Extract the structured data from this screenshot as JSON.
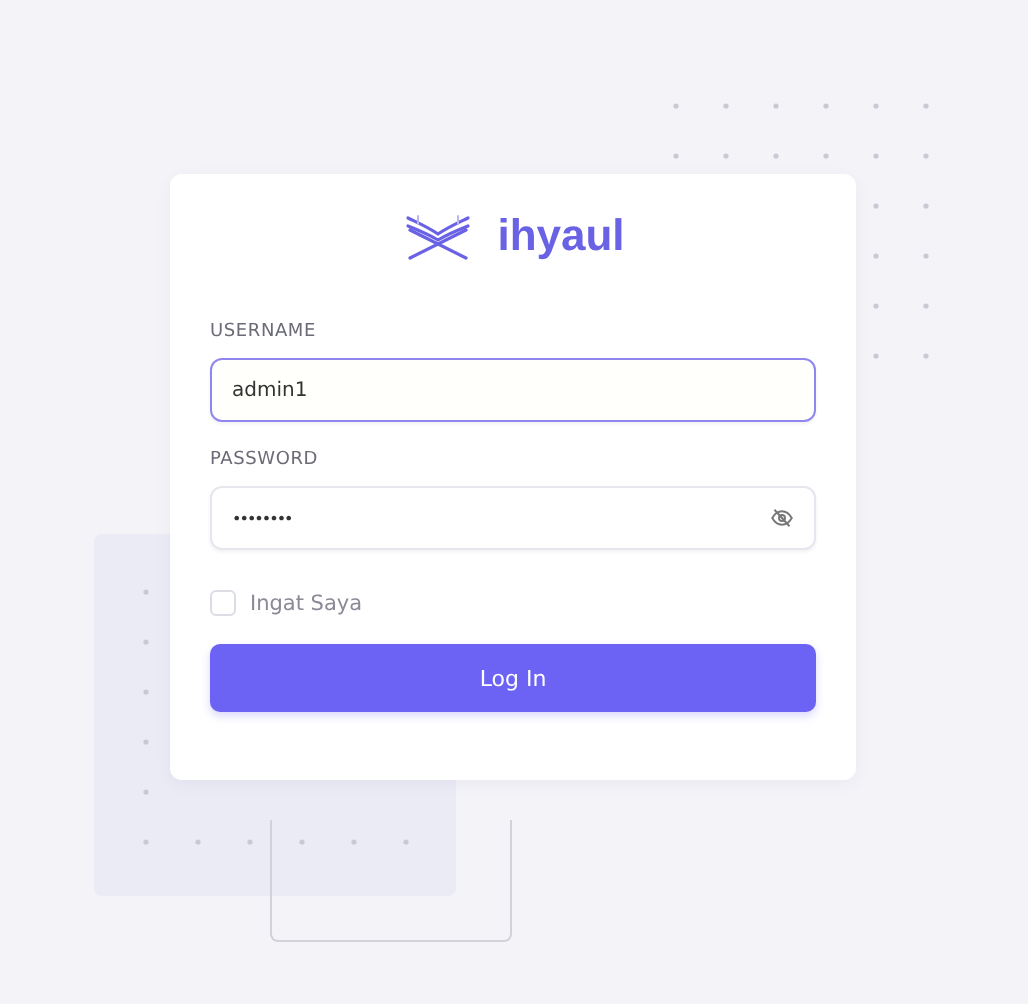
{
  "logo": {
    "text": "ihyaul"
  },
  "fields": [
    {
      "kind": "text",
      "label": "USERNAME",
      "value": "admin1",
      "focused": true
    },
    {
      "kind": "password",
      "label": "PASSWORD",
      "value": "••••••••",
      "focused": false
    }
  ],
  "remember": {
    "label": "Ingat Saya",
    "checked": false
  },
  "button": {
    "label": "Log In"
  }
}
